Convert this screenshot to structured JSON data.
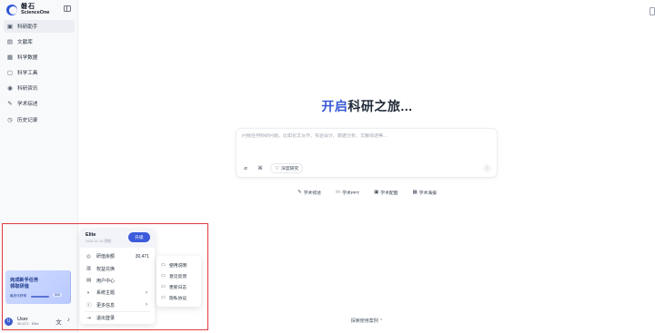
{
  "brand": {
    "name_cn": "磐石",
    "name_en": "ScienceOne"
  },
  "sidebar": {
    "items": [
      {
        "label": "科研助手",
        "icon": "chat-icon",
        "active": true
      },
      {
        "label": "文献库",
        "icon": "library-icon",
        "active": false
      },
      {
        "label": "科学数据",
        "icon": "database-icon",
        "active": false
      },
      {
        "label": "科学工具",
        "icon": "tool-icon",
        "active": false
      },
      {
        "label": "科研资讯",
        "icon": "news-icon",
        "active": false
      },
      {
        "label": "学术综述",
        "icon": "review-icon",
        "active": false
      },
      {
        "label": "历史记录",
        "icon": "history-icon",
        "active": false
      }
    ]
  },
  "promo": {
    "title_line1": "完成新手任务",
    "title_line2": "领取研值",
    "subtitle": "最多可获得",
    "badge": "500"
  },
  "user": {
    "name": "User",
    "meta": "30,471 · Elite",
    "avatar_initial": "U"
  },
  "main": {
    "hero_highlight": "开启",
    "hero_rest": "科研之旅...",
    "prompt_placeholder": "问我任何科研问题，比如论文写作、实验设计、数据分析、文献综述等...",
    "deep_research_label": "深度研究",
    "quick_actions": [
      {
        "label": "学术综述",
        "icon": "pen-icon"
      },
      {
        "label": "学术PPT",
        "icon": "presentation-icon"
      },
      {
        "label": "学术配图",
        "icon": "image-icon"
      },
      {
        "label": "学术海报",
        "icon": "poster-icon"
      }
    ],
    "explore_label": "探索使用案例"
  },
  "plan_menu": {
    "plan_name": "Elite",
    "expire": "2026-01-15 到期",
    "upgrade_label": "升级",
    "items": [
      {
        "label": "研值余额",
        "value": "30,471",
        "icon": "coin-icon"
      },
      {
        "label": "权益兑换",
        "value": "",
        "icon": "gift-icon"
      },
      {
        "label": "用户中心",
        "value": "",
        "icon": "user-icon"
      },
      {
        "label": "系统主题",
        "value": "",
        "icon": "theme-icon",
        "submenu": true
      },
      {
        "label": "更多信息",
        "value": "",
        "icon": "info-icon",
        "submenu": true
      }
    ],
    "logout_label": "退出登录"
  },
  "sub_menu": {
    "items": [
      {
        "label": "使用说明",
        "icon": "doc-icon"
      },
      {
        "label": "意见反馈",
        "icon": "feedback-icon"
      },
      {
        "label": "更新日志",
        "icon": "log-icon"
      },
      {
        "label": "隐私协议",
        "icon": "shield-icon"
      }
    ]
  },
  "colors": {
    "accent": "#3557d6",
    "highlight_frame": "#e23b3b",
    "sidebar_bg": "#f8f9fb"
  }
}
